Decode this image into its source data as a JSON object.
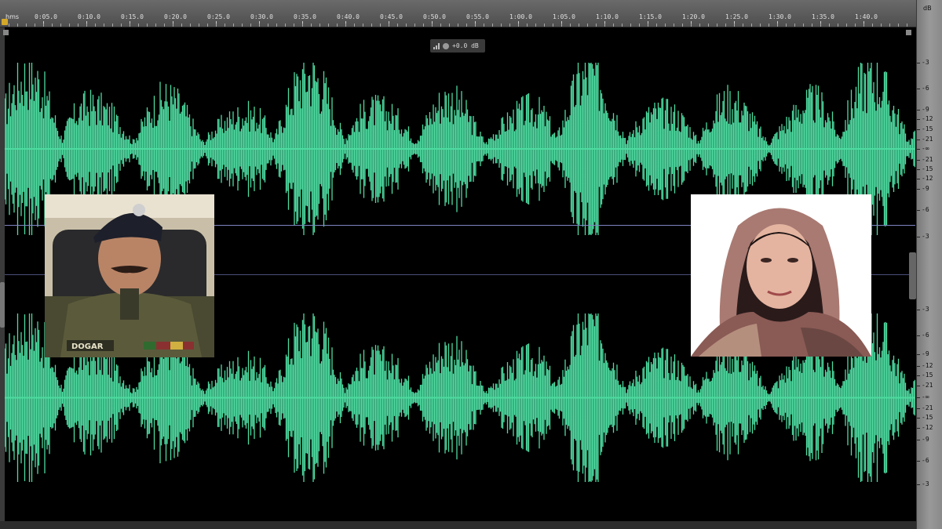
{
  "time_ruler": {
    "unit_label": "hms",
    "ticks": [
      "0:05.0",
      "0:10.0",
      "0:15.0",
      "0:20.0",
      "0:25.0",
      "0:30.0",
      "0:35.0",
      "0:40.0",
      "0:45.0",
      "0:50.0",
      "0:55.0",
      "1:00.0",
      "1:05.0",
      "1:10.0",
      "1:15.0",
      "1:20.0",
      "1:25.0",
      "1:30.0",
      "1:35.0",
      "1:40.0"
    ]
  },
  "db_ruler": {
    "unit": "dB",
    "channel_1_labels": [
      "-3",
      "-6",
      "-9",
      "-12",
      "-15",
      "-21",
      "-∞",
      "-21",
      "-15",
      "-12",
      "-9",
      "-6",
      "-3"
    ],
    "channel_2_labels": [
      "-3",
      "-6",
      "-9",
      "-12",
      "-15",
      "-21",
      "-∞",
      "-21",
      "-15",
      "-12",
      "-9",
      "-6",
      "-3"
    ]
  },
  "hud": {
    "value": "+0.0 dB"
  },
  "waveform": {
    "color": "#4ddba0",
    "background": "#000000",
    "divider_color": "#7e84c0"
  },
  "photos": {
    "left": {
      "name_tag": "DOGAR"
    },
    "right": {}
  },
  "icons": {
    "hud_level": "level-bars-icon",
    "hud_knob": "volume-knob-icon",
    "playhead": "playhead-marker-icon"
  }
}
